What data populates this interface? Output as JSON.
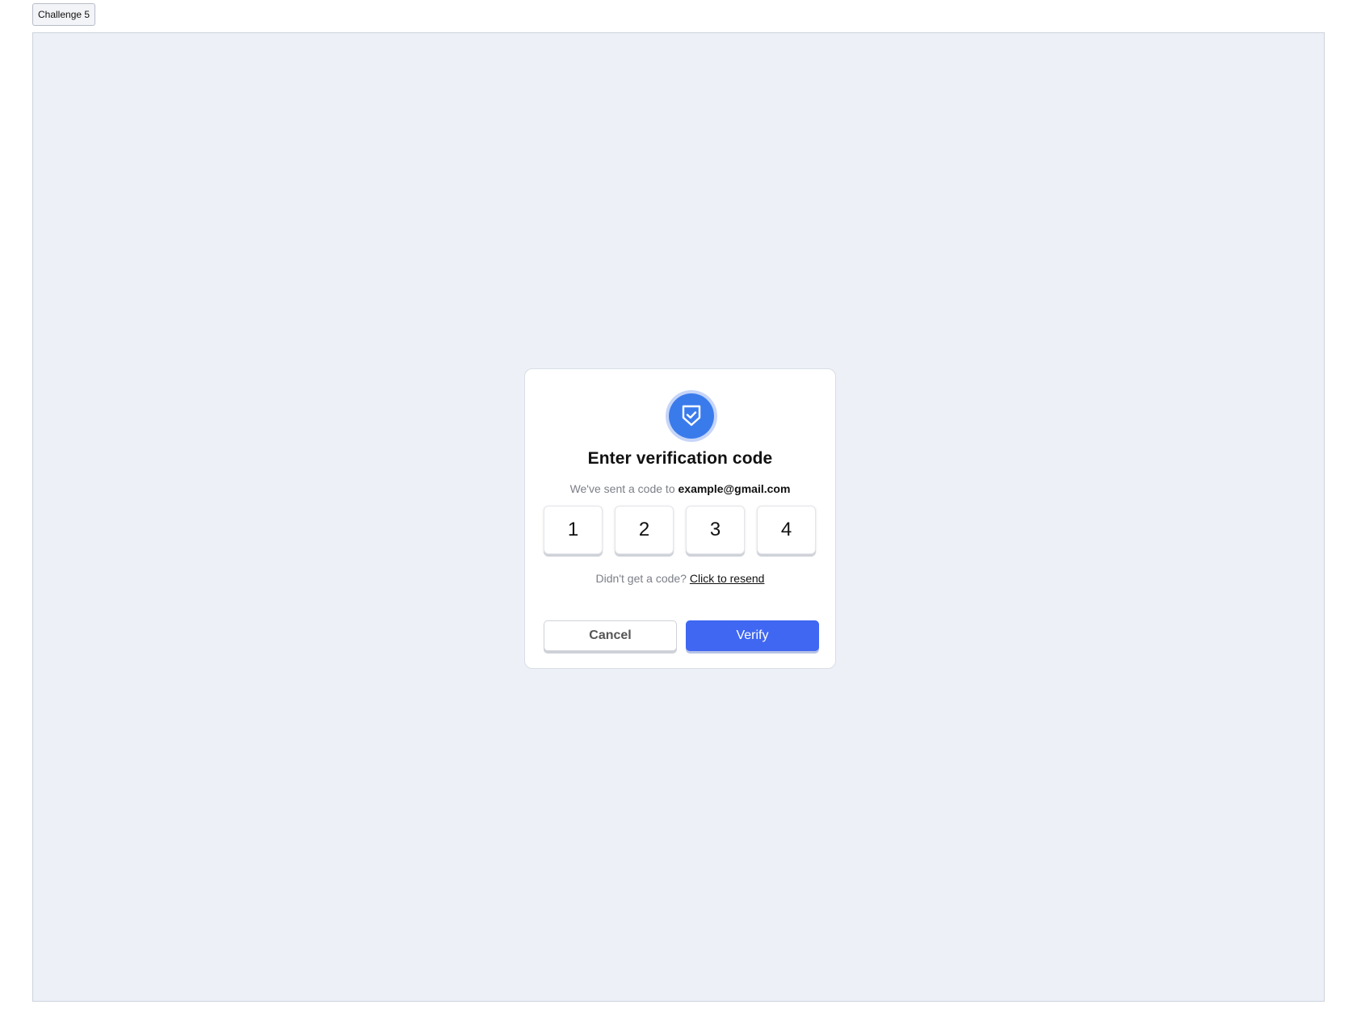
{
  "top_tab": {
    "label": "Challenge 5"
  },
  "modal": {
    "icon": "shield-check-icon",
    "title": "Enter verification code",
    "subtitle_prefix": "We've sent a code to",
    "email": "example@gmail.com",
    "code_digits": [
      "1",
      "2",
      "3",
      "4"
    ],
    "resend_prompt": "Didn't get a code?",
    "resend_link": "Click to resend",
    "cancel_label": "Cancel",
    "verify_label": "Verify"
  },
  "colors": {
    "accent": "#3f67f2",
    "shield": "#3a7bec",
    "stage_bg": "#edf0f7"
  }
}
